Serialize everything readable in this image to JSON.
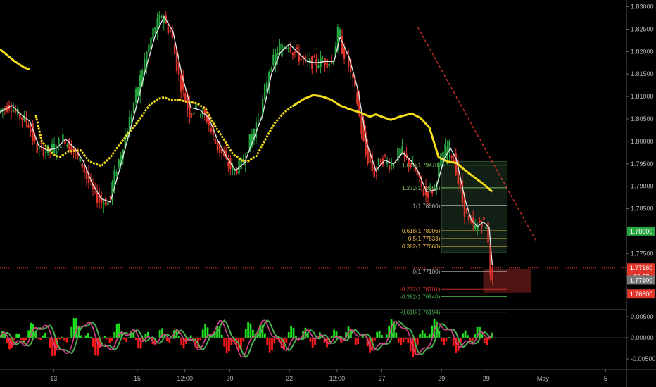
{
  "chart_data": {
    "type": "candlestick",
    "price_axis": {
      "ticks": [
        "1.83000",
        "1.82500",
        "1.82000",
        "1.81500",
        "1.81000",
        "1.80500",
        "1.80000",
        "1.79500",
        "1.79000",
        "1.78500",
        "1.78000",
        "1.77500",
        "1.77000"
      ],
      "tick_values": [
        1.83,
        1.825,
        1.82,
        1.815,
        1.81,
        1.805,
        1.8,
        1.795,
        1.79,
        1.785,
        1.78,
        1.775,
        1.77
      ],
      "range": [
        1.7625,
        1.8315
      ]
    },
    "oscillator_axis": {
      "ticks": [
        "0.00500",
        "0.00000",
        "-0.00500"
      ],
      "tick_values": [
        0.005,
        0.0,
        -0.005
      ],
      "range": [
        -0.0075,
        0.0065
      ]
    },
    "x_axis": {
      "labels": [
        "13",
        "15",
        "12:00",
        "20",
        "22",
        "12:00",
        "27",
        "29",
        "29",
        "May",
        "5"
      ],
      "positions": [
        8,
        36,
        52,
        67,
        87,
        103,
        118,
        138,
        153,
        172,
        193
      ],
      "range": [
        -10,
        200
      ]
    },
    "price_labels": [
      {
        "text": "1.78000",
        "value": 1.78,
        "color": "#26a641"
      },
      {
        "text": "1.77180",
        "value": 1.7718,
        "color": "#e0352b"
      },
      {
        "text": "16:57",
        "value": 1.7699,
        "color": "#e0352b"
      },
      {
        "text": "1.77100",
        "value": 1.7691,
        "color": "#777777"
      },
      {
        "text": "1.76600",
        "value": 1.766,
        "color": "#e0352b"
      }
    ],
    "current_price": 1.7718,
    "fib_levels": [
      {
        "label": "1.618(1.79470)",
        "value": 1.7947,
        "color": "#8fd16a"
      },
      {
        "label": "1.272(1.78965)",
        "value": 1.78965,
        "color": "#8fd16a"
      },
      {
        "label": "1(1.78566)",
        "value": 1.78566,
        "color": "#b5b5b5"
      },
      {
        "label": "0.618(1.78006)",
        "value": 1.78006,
        "color": "#f5c043"
      },
      {
        "label": "0.5(1.77833)",
        "value": 1.77833,
        "color": "#f5c043"
      },
      {
        "label": "0.382(1.77660)",
        "value": 1.7766,
        "color": "#f5c043"
      },
      {
        "label": "0(1.77100)",
        "value": 1.771,
        "color": "#b5b5b5"
      },
      {
        "label": "-0.272(1.76701)",
        "value": 1.76701,
        "color": "#e0352b"
      },
      {
        "label": "-0.382(1.76540)",
        "value": 1.7654,
        "color": "#4caf50"
      },
      {
        "label": "-0.618(1.76194)",
        "value": 1.76194,
        "color": "#4caf50"
      }
    ],
    "fib_range_x": [
      138,
      160
    ],
    "trendline": {
      "start": [
        130,
        1.8255
      ],
      "end": [
        170,
        1.7775
      ],
      "color": "#e0352b"
    },
    "profit_zone": {
      "x": [
        138,
        160
      ],
      "y": [
        1.7752,
        1.7955
      ],
      "color": "#6ec07a"
    },
    "loss_zone": {
      "x": [
        152,
        168
      ],
      "y": [
        1.7663,
        1.7715
      ],
      "color": "#c43333"
    },
    "ma_slow": [
      [
        -10,
        1.8205
      ],
      [
        -5,
        1.8178
      ],
      [
        -2,
        1.8165
      ],
      [
        0,
        1.816
      ],
      [
        2,
        1.8058
      ],
      [
        4,
        1.8
      ],
      [
        6,
        1.7985
      ],
      [
        8,
        1.797
      ],
      [
        10,
        1.7965
      ],
      [
        13,
        1.7978
      ],
      [
        17,
        1.798
      ],
      [
        20,
        1.7955
      ],
      [
        24,
        1.7945
      ],
      [
        27,
        1.7965
      ],
      [
        30,
        1.7992
      ],
      [
        33,
        1.8018
      ],
      [
        36,
        1.8042
      ],
      [
        40,
        1.808
      ],
      [
        43,
        1.8095
      ],
      [
        45,
        1.8098
      ],
      [
        47,
        1.8093
      ],
      [
        50,
        1.8092
      ],
      [
        53,
        1.8088
      ],
      [
        56,
        1.8085
      ],
      [
        59,
        1.8072
      ],
      [
        62,
        1.8035
      ],
      [
        65,
        1.8005
      ],
      [
        68,
        1.7972
      ],
      [
        71,
        1.7958
      ],
      [
        73,
        1.7955
      ],
      [
        76,
        1.7968
      ],
      [
        79,
        1.8005
      ],
      [
        82,
        1.804
      ],
      [
        85,
        1.8063
      ],
      [
        88,
        1.8078
      ],
      [
        92,
        1.8095
      ],
      [
        95,
        1.8103
      ],
      [
        98,
        1.81
      ],
      [
        101,
        1.8093
      ],
      [
        104,
        1.808
      ],
      [
        107,
        1.8072
      ],
      [
        111,
        1.8064
      ],
      [
        114,
        1.8055
      ],
      [
        116,
        1.806
      ],
      [
        118,
        1.8055
      ],
      [
        121,
        1.8048
      ],
      [
        124,
        1.8055
      ],
      [
        128,
        1.8062
      ],
      [
        131,
        1.8052
      ],
      [
        134,
        1.803
      ],
      [
        137,
        1.7965
      ],
      [
        140,
        1.7955
      ],
      [
        143,
        1.7952
      ],
      [
        146,
        1.7935
      ],
      [
        149,
        1.792
      ],
      [
        152,
        1.7905
      ],
      [
        155,
        1.7888
      ]
    ],
    "ma_fast": [
      [
        -10,
        1.8065
      ],
      [
        -6,
        1.808
      ],
      [
        -3,
        1.806
      ],
      [
        0,
        1.8045
      ],
      [
        3,
        1.799
      ],
      [
        6,
        1.798
      ],
      [
        9,
        1.7985
      ],
      [
        12,
        1.8005
      ],
      [
        15,
        1.7985
      ],
      [
        18,
        1.7955
      ],
      [
        21,
        1.7905
      ],
      [
        24,
        1.7872
      ],
      [
        27,
        1.7865
      ],
      [
        30,
        1.7935
      ],
      [
        33,
        1.801
      ],
      [
        36,
        1.8085
      ],
      [
        39,
        1.8165
      ],
      [
        42,
        1.8235
      ],
      [
        45,
        1.8278
      ],
      [
        48,
        1.8245
      ],
      [
        51,
        1.8148
      ],
      [
        54,
        1.8075
      ],
      [
        57,
        1.807
      ],
      [
        60,
        1.8053
      ],
      [
        63,
        1.8002
      ],
      [
        66,
        1.7965
      ],
      [
        69,
        1.7935
      ],
      [
        72,
        1.7952
      ],
      [
        75,
        1.8005
      ],
      [
        78,
        1.8058
      ],
      [
        81,
        1.815
      ],
      [
        84,
        1.8198
      ],
      [
        87,
        1.8217
      ],
      [
        90,
        1.8197
      ],
      [
        93,
        1.8178
      ],
      [
        96,
        1.8175
      ],
      [
        99,
        1.8178
      ],
      [
        102,
        1.8178
      ],
      [
        104,
        1.8232
      ],
      [
        107,
        1.8188
      ],
      [
        110,
        1.8115
      ],
      [
        113,
        1.7995
      ],
      [
        116,
        1.7935
      ],
      [
        119,
        1.7958
      ],
      [
        122,
        1.795
      ],
      [
        125,
        1.7975
      ],
      [
        128,
        1.7955
      ],
      [
        130,
        1.7935
      ],
      [
        133,
        1.7888
      ],
      [
        136,
        1.7892
      ],
      [
        139,
        1.7963
      ],
      [
        141,
        1.7985
      ],
      [
        143,
        1.796
      ],
      [
        146,
        1.7868
      ],
      [
        148,
        1.7825
      ],
      [
        150,
        1.781
      ],
      [
        152,
        1.782
      ],
      [
        154,
        1.7808
      ],
      [
        155,
        1.7725
      ]
    ],
    "series_color_up": "#26a641",
    "series_color_down": "#e0352b",
    "ma_slow_color": "#f2dc1a",
    "ma_fast_color": "#e8e8e8"
  }
}
